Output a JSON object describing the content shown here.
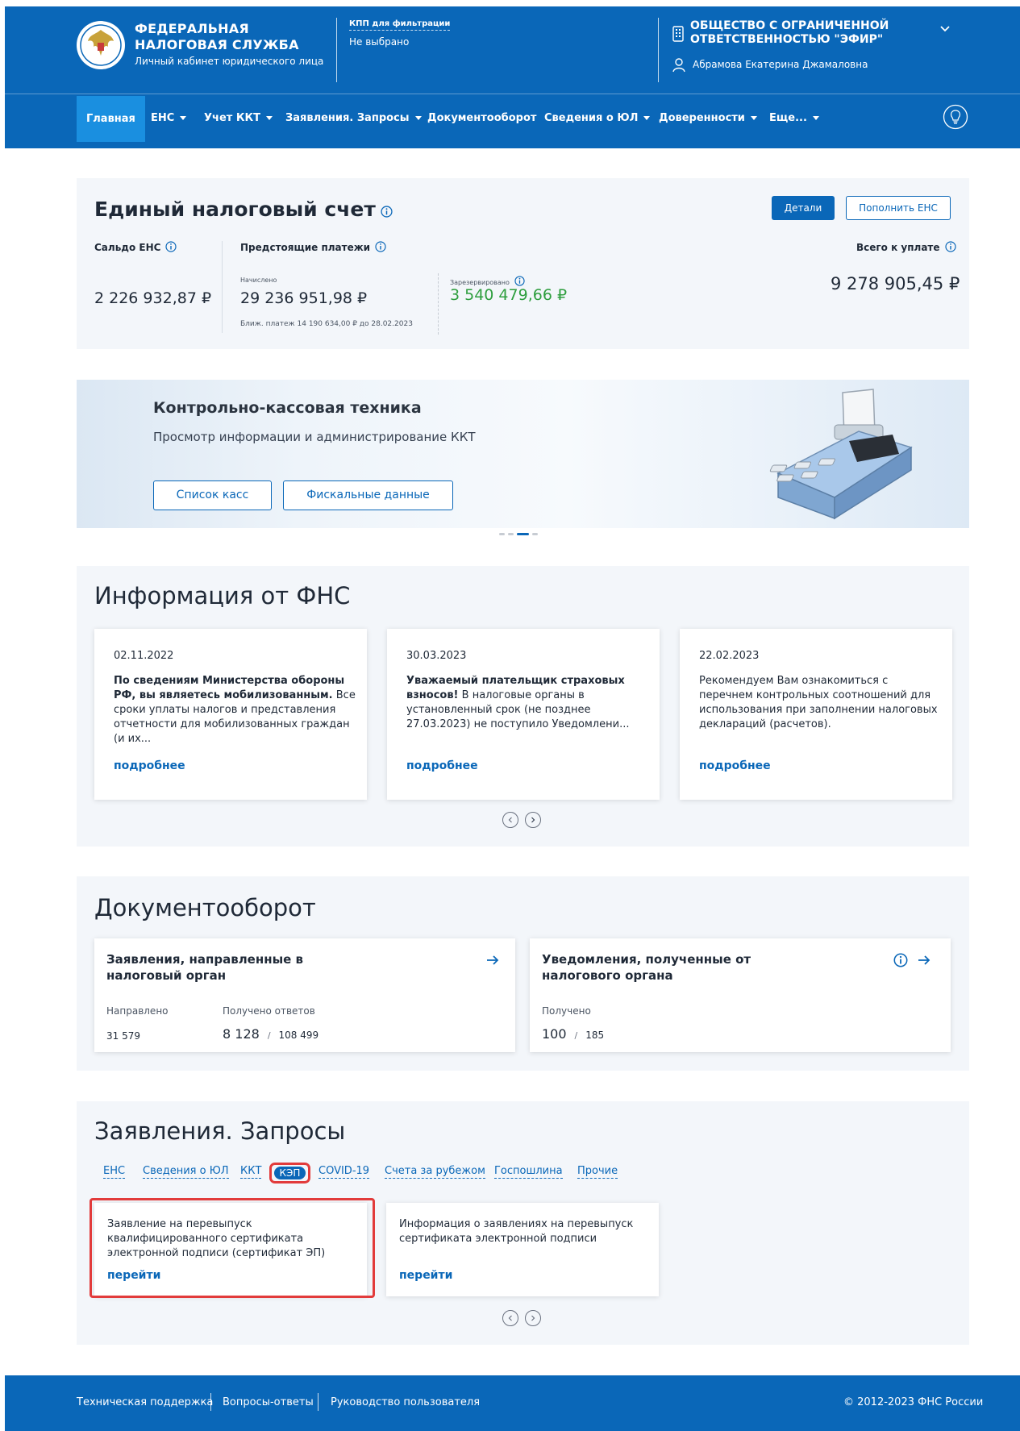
{
  "header": {
    "org_line1": "ФЕДЕРАЛЬНАЯ",
    "org_line2": "НАЛОГОВАЯ СЛУЖБА",
    "org_sub": "Личный кабинет юридического лица",
    "kpp_label": "КПП для фильтрации",
    "kpp_value": "Не выбрано",
    "company_line1": "ОБЩЕСТВО С ОГРАНИЧЕННОЙ",
    "company_line2": "ОТВЕТСТВЕННОСТЬЮ \"ЭФИР\"",
    "user_name": "Абрамова Екатерина Джамаловна"
  },
  "nav": {
    "items": [
      {
        "label": "Главная"
      },
      {
        "label": "ЕНС"
      },
      {
        "label": "Учет ККТ"
      },
      {
        "label": "Заявления. Запросы"
      },
      {
        "label": "Документооборот"
      },
      {
        "label": "Сведения о ЮЛ"
      },
      {
        "label": "Доверенности"
      },
      {
        "label": "Еще..."
      }
    ]
  },
  "ens": {
    "title": "Единый налоговый счет",
    "details_button": "Детали",
    "topup_button": "Пополнить ЕНС",
    "saldo_label": "Сальдо ЕНС",
    "saldo_value": "2 226 932,87 ₽",
    "upcoming_label": "Предстоящие платежи",
    "accrued_label": "Начислено",
    "accrued_value": "29 236 951,98 ₽",
    "nearest_payment": "Ближ. платеж 14 190 634,00 ₽ до 28.02.2023",
    "reserved_label": "Зарезервировано",
    "reserved_value": "3 540 479,66 ₽",
    "total_label": "Всего к уплате",
    "total_value": "9 278 905,45 ₽"
  },
  "kkt_banner": {
    "title": "Контрольно-кассовая техника",
    "subtitle": "Просмотр информации и администрирование ККТ",
    "button_list": "Список касс",
    "button_fiscal": "Фискальные данные"
  },
  "fns_info": {
    "title": "Информация от ФНС",
    "more": "подробнее",
    "items": [
      {
        "date": "02.11.2022",
        "bold": "По сведениям Министерства обороны РФ, вы являетесь мобилизованным.",
        "text": "Все сроки уплаты налогов и представления отчетности для мобилизованных граждан (и их..."
      },
      {
        "date": "30.03.2023",
        "bold": "Уважаемый плательщик страховых взносов!",
        "text": "В налоговые органы в установленный срок (не позднее 27.03.2023) не поступило Уведомлени..."
      },
      {
        "date": "22.02.2023",
        "bold": "",
        "text": "Рекомендуем Вам ознакомиться с перечнем контрольных соотношений для использования при заполнении налоговых деклараций (расчетов)."
      }
    ]
  },
  "docflow": {
    "title": "Документооборот",
    "sent": {
      "title": "Заявления, направленные в налоговый орган",
      "sent_label": "Направлено",
      "sent_value": "31 579",
      "answers_label": "Получено ответов",
      "answers_value": "8 128",
      "answers_total": "108 499"
    },
    "received": {
      "title": "Уведомления, полученные от налогового органа",
      "received_label": "Получено",
      "received_value": "100",
      "received_total": "185"
    },
    "slash": "/"
  },
  "requests": {
    "title": "Заявления. Запросы",
    "tabs": [
      "ЕНС",
      "Сведения о ЮЛ",
      "ККТ",
      "КЭП",
      "COVID-19",
      "Счета за рубежом",
      "Госпошлина",
      "Прочие"
    ],
    "active_tab": "КЭП",
    "cards": [
      {
        "text": "Заявление на перевыпуск квалифицированного сертификата электронной подписи (сертификат ЭП)",
        "link": "перейти"
      },
      {
        "text": "Информация о заявлениях на перевыпуск сертификата электронной подписи",
        "link": "перейти"
      }
    ]
  },
  "footer": {
    "support": "Техническая поддержка",
    "faq": "Вопросы-ответы",
    "guide": "Руководство пользователя",
    "copyright": "© 2012-2023 ФНС России"
  },
  "colors": {
    "brand_blue": "#0a67b8",
    "active_nav": "#1a8fe0",
    "reserved_green": "#2e9e3e",
    "highlight_red": "#e23b3b"
  }
}
